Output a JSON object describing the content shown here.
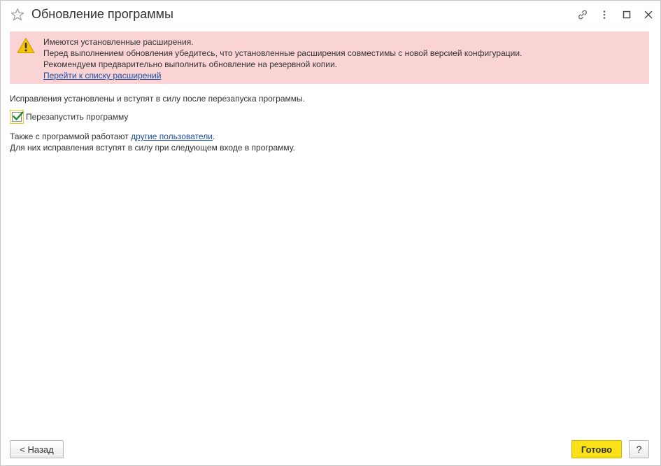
{
  "window": {
    "title": "Обновление программы"
  },
  "warning": {
    "line1": "Имеются установленные расширения.",
    "line2": "Перед выполнением обновления убедитесь, что установленные расширения совместимы с новой версией конфигурации.",
    "line3": "Рекомендуем предварительно выполнить обновление на резервной копии.",
    "link": "Перейти к списку расширений"
  },
  "content": {
    "info_text": "Исправления установлены и вступят в силу после перезапуска программы.",
    "restart_checkbox": {
      "label": "Перезапустить программу",
      "checked": true
    },
    "users_prefix": "Также с программой работают ",
    "users_link": "другие пользователи",
    "users_suffix": ".",
    "users_line2": "Для них исправления вступят в силу при следующем входе в программу."
  },
  "footer": {
    "back_label": "< Назад",
    "done_label": "Готово",
    "help_label": "?"
  },
  "colors": {
    "warning_bg": "#fad4d4",
    "primary_button": "#fbe118",
    "link": "#1c4fa0",
    "checkmark": "#1e8a2e"
  },
  "icons": {
    "favorite": "star-icon",
    "link": "link-icon",
    "more": "more-vertical-icon",
    "maximize": "maximize-icon",
    "close": "close-icon",
    "warning": "warning-icon",
    "check": "checkmark-icon"
  }
}
